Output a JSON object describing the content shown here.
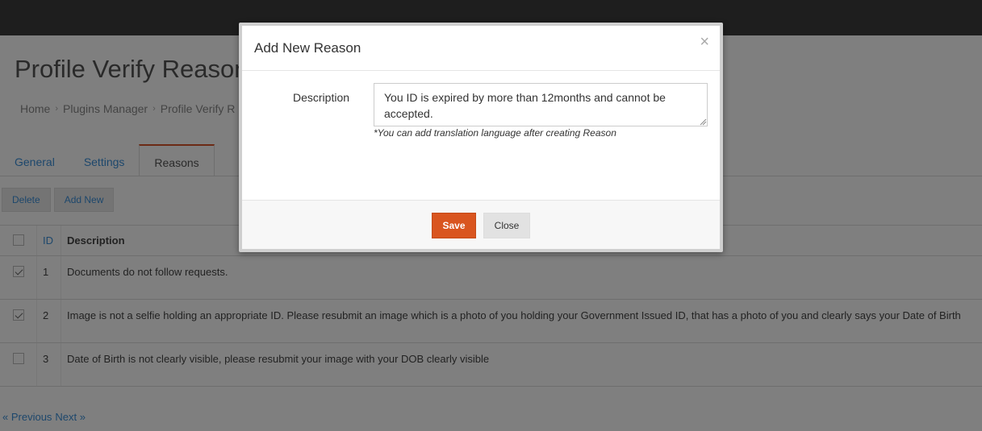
{
  "page": {
    "title": "Profile Verify Reasons",
    "breadcrumb": [
      "Home",
      "Plugins Manager",
      "Profile Verify R"
    ],
    "tabs": [
      "General",
      "Settings",
      "Reasons"
    ],
    "actions": {
      "delete_label": "Delete",
      "add_new_label": "Add New"
    },
    "table": {
      "headers": {
        "id": "ID",
        "description": "Description"
      },
      "rows": [
        {
          "id": "1",
          "description": "Documents do not follow requests.",
          "checked": true
        },
        {
          "id": "2",
          "description": "Image is not a selfie holding an appropriate ID. Please resubmit an image which is a photo of you holding your Government Issued ID, that has a photo of you and clearly says your Date of Birth",
          "checked": true
        },
        {
          "id": "3",
          "description": "Date of Birth is not clearly visible, please resubmit your image with your DOB clearly visible",
          "checked": false
        }
      ]
    },
    "pager": {
      "previous_label": "« Previous",
      "next_label": "Next »"
    }
  },
  "modal": {
    "title": "Add New Reason",
    "close_symbol": "×",
    "field_label": "Description",
    "description_value": "You ID is expired by more than 12months and cannot be accepted.",
    "help_text": "*You can add translation language after creating Reason",
    "save_label": "Save",
    "close_label": "Close"
  },
  "colors": {
    "accent": "#d9551f",
    "link": "#3b8fd8",
    "topbar": "#3c3c3c"
  }
}
